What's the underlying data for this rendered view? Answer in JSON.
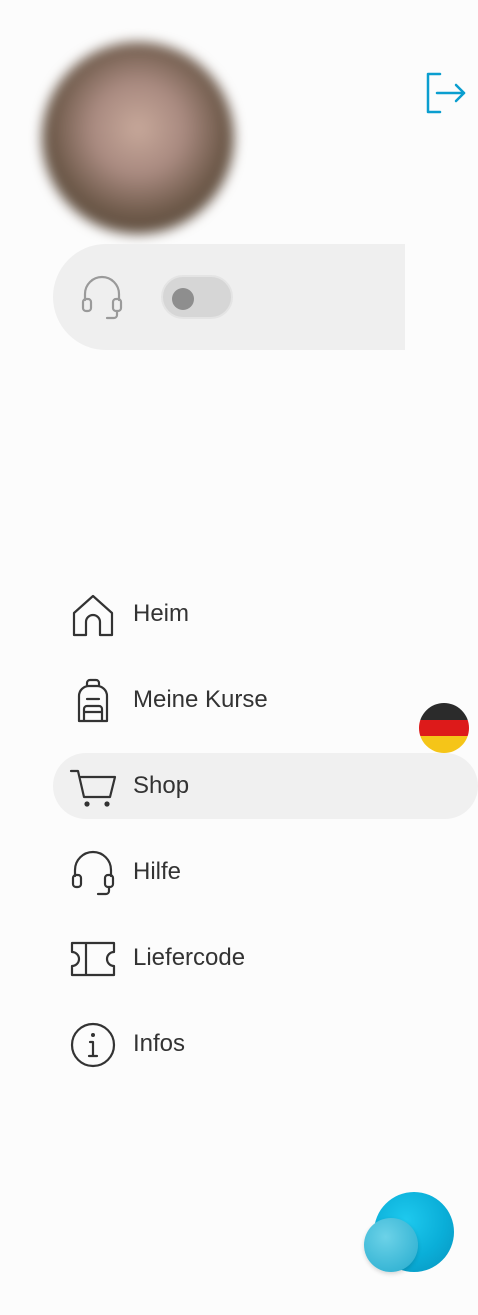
{
  "header": {
    "avatar_icon": "user-avatar",
    "logout_icon": "logout-icon",
    "accent_color": "#0a9ecf"
  },
  "support": {
    "icon": "headset-icon",
    "toggle_state": "off"
  },
  "nav": {
    "items": [
      {
        "label": "Heim",
        "icon": "home-icon",
        "active": false
      },
      {
        "label": "Meine Kurse",
        "icon": "backpack-icon",
        "active": false
      },
      {
        "label": "Shop",
        "icon": "cart-icon",
        "active": true
      },
      {
        "label": "Hilfe",
        "icon": "headset-icon",
        "active": false
      },
      {
        "label": "Liefercode",
        "icon": "ticket-icon",
        "active": false
      },
      {
        "label": "Infos",
        "icon": "info-icon",
        "active": false
      }
    ]
  },
  "language": {
    "icon": "german-flag-icon",
    "colors": [
      "#2b2b2b",
      "#dd1a1a",
      "#f5c518"
    ]
  },
  "fab": {
    "icon": "chat-bubbles-icon",
    "colors": [
      "#0aaed8",
      "#3ab7d6"
    ]
  }
}
